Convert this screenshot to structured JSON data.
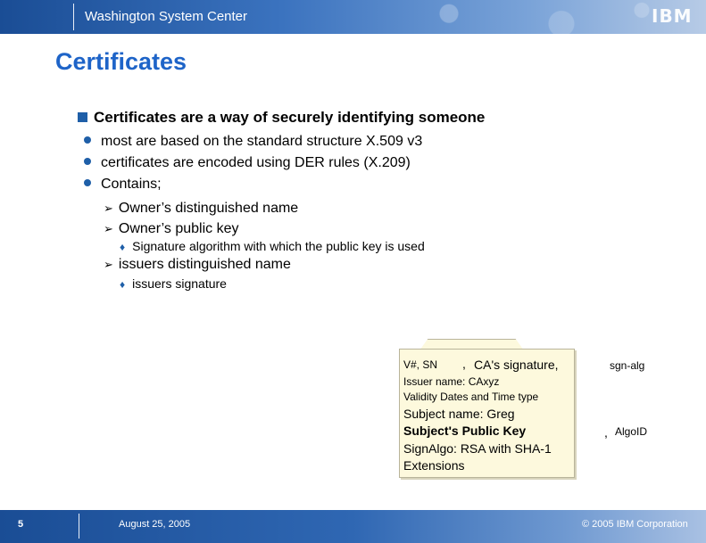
{
  "header": {
    "title": "Washington System Center",
    "logo": "IBM"
  },
  "slide": {
    "title": "Certificates",
    "main_bullet": "Certificates are a way of securely identifying someone",
    "sub_bullets": [
      "most are based on the standard structure X.509 v3",
      "certificates are encoded using DER rules (X.209)",
      "Contains;"
    ],
    "contains_items": [
      "Owner’s distinguished name",
      "Owner’s  public key",
      "issuers distinguished name"
    ],
    "detail_items": [
      "Signature algorithm with which the public key is used",
      "issuers signature"
    ]
  },
  "certificate": {
    "line1_left": "V#, SN",
    "line1_comma": ",",
    "line1_right": "CA's signature,",
    "issuer": "Issuer name: CAxyz",
    "validity": "Validity Dates and Time type",
    "subject": "Subject name: Greg",
    "public_key": "Subject's Public Key",
    "sign_algo": "SignAlgo: RSA with SHA-1",
    "extensions": "Extensions",
    "sgn_alg": "sgn-alg",
    "algo_comma": ",",
    "algo_id": "AlgoID"
  },
  "footer": {
    "page": "5",
    "date": "August 25, 2005",
    "copyright": "© 2005 IBM Corporation"
  },
  "colors": {
    "title": "#1e64c8",
    "bullet": "#1f5fa8",
    "header_dark": "#1a4d95",
    "cert_fill": "#fdf9dd"
  }
}
